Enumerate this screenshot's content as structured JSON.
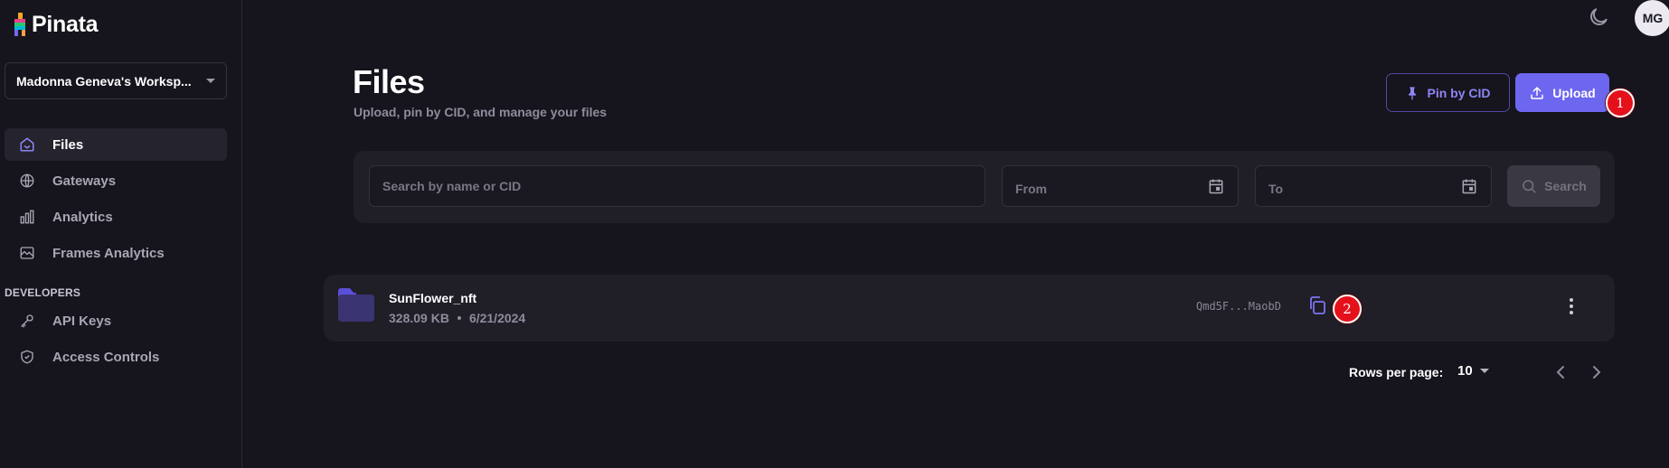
{
  "app": {
    "name": "Pinata"
  },
  "sidebar": {
    "workspace": "Madonna Geneva's Worksp...",
    "items": [
      {
        "label": "Files",
        "icon": "home-icon",
        "active": true
      },
      {
        "label": "Gateways",
        "icon": "globe-icon",
        "active": false
      },
      {
        "label": "Analytics",
        "icon": "bar-chart-icon",
        "active": false
      },
      {
        "label": "Frames Analytics",
        "icon": "image-chart-icon",
        "active": false
      }
    ],
    "developers_label": "DEVELOPERS",
    "dev_items": [
      {
        "label": "API Keys",
        "icon": "key-icon"
      },
      {
        "label": "Access Controls",
        "icon": "shield-icon"
      }
    ]
  },
  "topbar": {
    "avatar_initials": "MG",
    "theme_icon": "moon-icon"
  },
  "header": {
    "title": "Files",
    "subtitle": "Upload, pin by CID, and manage your files",
    "pin_label": "Pin by CID",
    "upload_label": "Upload"
  },
  "markers": {
    "m1": "1",
    "m2": "2"
  },
  "search": {
    "placeholder": "Search by name or CID",
    "from_placeholder": "From",
    "to_placeholder": "To",
    "button_label": "Search"
  },
  "files": [
    {
      "name": "SunFlower_nft",
      "size": "328.09 KB",
      "date": "6/21/2024",
      "cid": "Qmd5F...MaobD"
    }
  ],
  "pagination": {
    "rows_label": "Rows per page:",
    "rows_value": "10"
  },
  "colors": {
    "accent": "#6d66ee",
    "background": "#16141c",
    "panel": "#201e27"
  }
}
